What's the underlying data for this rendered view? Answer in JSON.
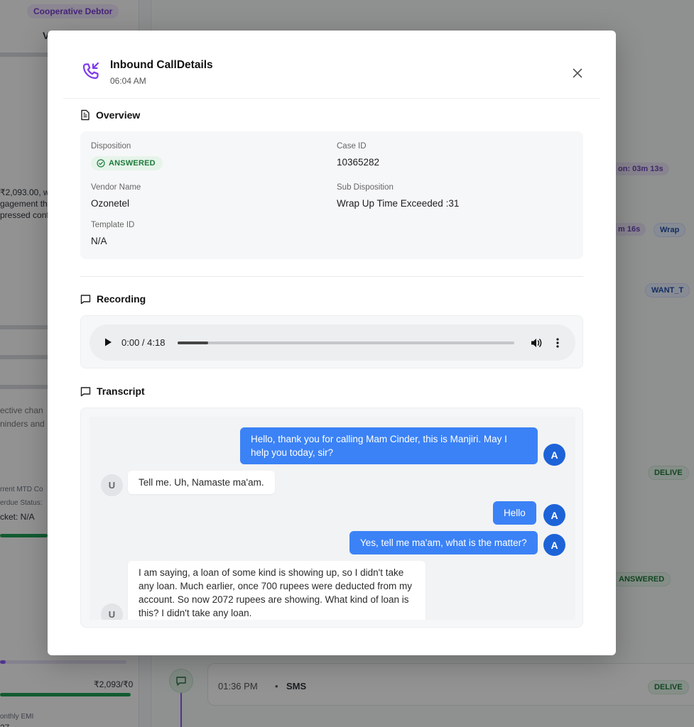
{
  "background": {
    "debtor_badge": "Cooperative Debtor",
    "left_texts": [
      "V",
      "₹2,093.00, wh",
      "gagement th",
      "pressed conf",
      "ective chan",
      "ninders and",
      "rrent MTD Co",
      "erdue Status:",
      "cket: N/A",
      "₹2,093/₹0",
      "onthly EMI",
      "27"
    ],
    "right_chips": [
      "on: 03m 13s",
      "m 16s",
      "Wrap",
      "WANT_T",
      "DELIVE",
      "ANSWERED",
      "DELIVE"
    ],
    "sms_row": {
      "time": "01:36 PM",
      "sep": "•",
      "type": "SMS"
    }
  },
  "modal": {
    "title": "Inbound CallDetails",
    "time": "06:04 AM",
    "icon": "phone-incoming-icon",
    "accent_color": "#7c3aed"
  },
  "overview": {
    "heading": "Overview",
    "disposition_label": "Disposition",
    "disposition_value": "ANSWERED",
    "case_id_label": "Case ID",
    "case_id_value": "10365282",
    "vendor_label": "Vendor Name",
    "vendor_value": "Ozonetel",
    "sub_disposition_label": "Sub Disposition",
    "sub_disposition_value": "Wrap Up Time Exceeded :31",
    "template_label": "Template ID",
    "template_value": "N/A"
  },
  "recording": {
    "heading": "Recording",
    "time_display": "0:00 / 4:18",
    "buffered_fraction": 0.09
  },
  "transcript": {
    "heading": "Transcript",
    "agent_avatar": "A",
    "user_avatar": "U",
    "messages": [
      {
        "speaker": "agent",
        "text": "Hello, thank you for calling Mam Cinder, this is Manjiri. May I help you today, sir?"
      },
      {
        "speaker": "user",
        "text": "Tell me. Uh, Namaste ma'am."
      },
      {
        "speaker": "agent",
        "text": "Hello"
      },
      {
        "speaker": "agent",
        "text": "Yes, tell me ma'am, what is the matter?"
      },
      {
        "speaker": "user",
        "text": "I am saying, a loan of some kind is showing up, so I didn't take any loan. Much earlier, once 700 rupees were deducted from my account. So now 2072 rupees are showing. What kind of loan is this? I didn't take any loan."
      }
    ]
  }
}
